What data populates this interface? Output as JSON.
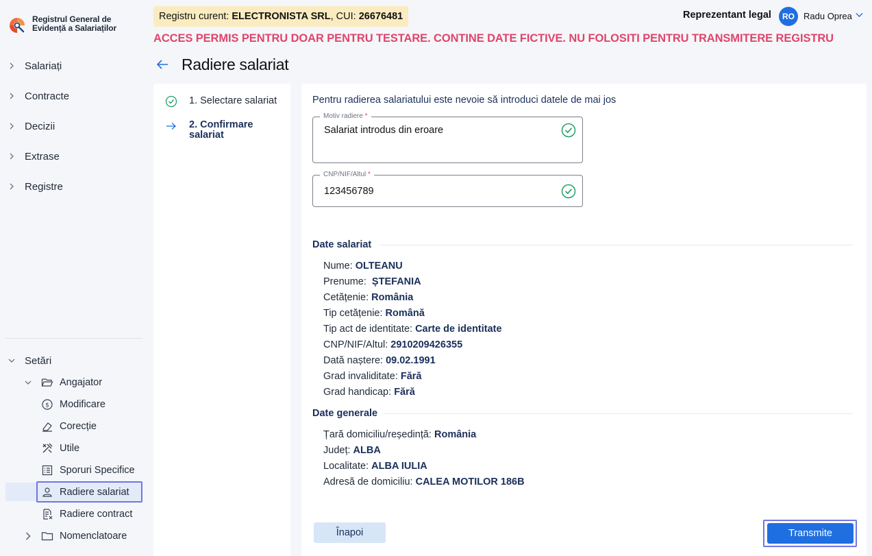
{
  "app": {
    "logo_line1": "Registrul General de",
    "logo_line2": "Evidență a Salariaților"
  },
  "sidebar": {
    "items": [
      {
        "label": "Salariați"
      },
      {
        "label": "Contracte"
      },
      {
        "label": "Decizii"
      },
      {
        "label": "Extrase"
      },
      {
        "label": "Registre"
      }
    ],
    "settings": {
      "label": "Setări",
      "angajator": "Angajator",
      "subitems": [
        {
          "label": "Modificare",
          "icon": "coin-swap-icon"
        },
        {
          "label": "Corecție",
          "icon": "eraser-icon"
        },
        {
          "label": "Utile",
          "icon": "tools-icon"
        },
        {
          "label": "Sporuri Specifice",
          "icon": "list-icon"
        },
        {
          "label": "Radiere salariat",
          "icon": "user-icon"
        },
        {
          "label": "Radiere contract",
          "icon": "document-remove-icon"
        }
      ],
      "nomenclatoare": "Nomenclatoare"
    }
  },
  "header": {
    "registry_prefix": "Registru curent: ",
    "company": "ELECTRONISTA SRL",
    "cui_prefix": ", CUI: ",
    "cui": "26676481",
    "representative": "Reprezentant legal",
    "avatar_initials": "RO",
    "user_name": "Radu Oprea",
    "warning": "ACCES PERMIS PENTRU DOAR PENTRU TESTARE. CONTINE DATE FICTIVE. NU FOLOSITI PENTRU TRANSMITERE REGISTRU"
  },
  "page": {
    "title": "Radiere salariat"
  },
  "steps": [
    {
      "label": "1. Selectare salariat",
      "state": "done"
    },
    {
      "label_line1": "2. Confirmare",
      "label_line2": "salariat",
      "state": "current"
    }
  ],
  "form": {
    "intro": "Pentru radierea salariatului este nevoie să introduci datele de mai jos",
    "motiv": {
      "label": "Motiv radiere",
      "required": "*",
      "value": "Salariat introdus din eroare"
    },
    "cnp": {
      "label": "CNP/NIF/Altul",
      "required": "*",
      "value": "123456789"
    }
  },
  "employee": {
    "title": "Date salariat",
    "rows": [
      {
        "k": "Nume: ",
        "v": "OLTEANU"
      },
      {
        "k": "Prenume: ",
        "v": " ȘTEFANIA"
      },
      {
        "k": "Cetățenie: ",
        "v": "România"
      },
      {
        "k": "Tip cetățenie: ",
        "v": "Română"
      },
      {
        "k": "Tip act de identitate: ",
        "v": "Carte de identitate"
      },
      {
        "k": "CNP/NIF/Altul: ",
        "v": "2910209426355"
      },
      {
        "k": "Dată naștere: ",
        "v": "09.02.1991"
      },
      {
        "k": "Grad invaliditate: ",
        "v": "Fără"
      },
      {
        "k": "Grad handicap: ",
        "v": "Fără"
      }
    ]
  },
  "general": {
    "title": "Date generale",
    "rows": [
      {
        "k": "Țară domiciliu/reședință: ",
        "v": "România"
      },
      {
        "k": "Județ: ",
        "v": "ALBA"
      },
      {
        "k": "Localitate: ",
        "v": "ALBA IULIA"
      },
      {
        "k": "Adresă de domiciliu: ",
        "v": "CALEA MOTILOR 186B"
      }
    ]
  },
  "buttons": {
    "back": "Înapoi",
    "submit": "Transmite"
  },
  "colors": {
    "accent": "#1f6fe0",
    "warning": "#e0456a",
    "success": "#22a06b",
    "highlight": "#6f76e3"
  }
}
